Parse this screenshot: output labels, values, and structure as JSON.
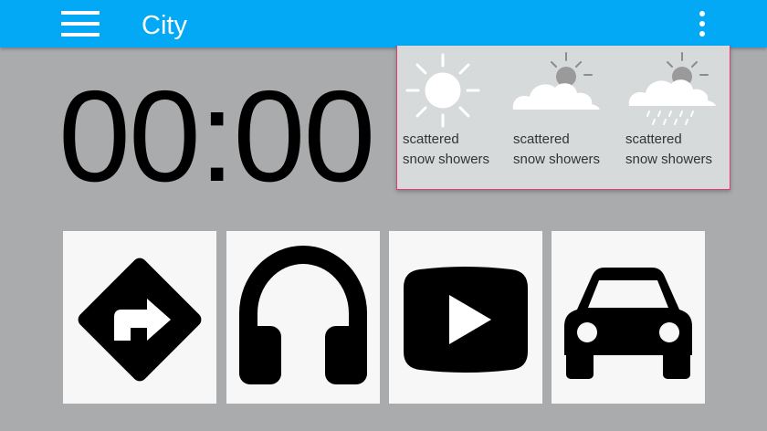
{
  "appbar": {
    "title": "City",
    "menu_icon": "menu-icon",
    "overflow_icon": "more-vert-icon",
    "color": "#03a9f4"
  },
  "clock": {
    "time": "00:00"
  },
  "weather": {
    "forecasts": [
      {
        "icon": "sun-icon",
        "line1": "scattered",
        "line2": "snow showers"
      },
      {
        "icon": "partly-cloudy-icon",
        "line1": "scattered",
        "line2": "snow showers"
      },
      {
        "icon": "snow-showers-icon",
        "line1": "scattered",
        "line2": "snow showers"
      }
    ],
    "border_color": "#e23b6c"
  },
  "tiles": [
    {
      "name": "navigation",
      "icon": "turn-right-sign-icon"
    },
    {
      "name": "music",
      "icon": "headphones-icon"
    },
    {
      "name": "video",
      "icon": "play-video-icon"
    },
    {
      "name": "car",
      "icon": "car-icon"
    }
  ]
}
